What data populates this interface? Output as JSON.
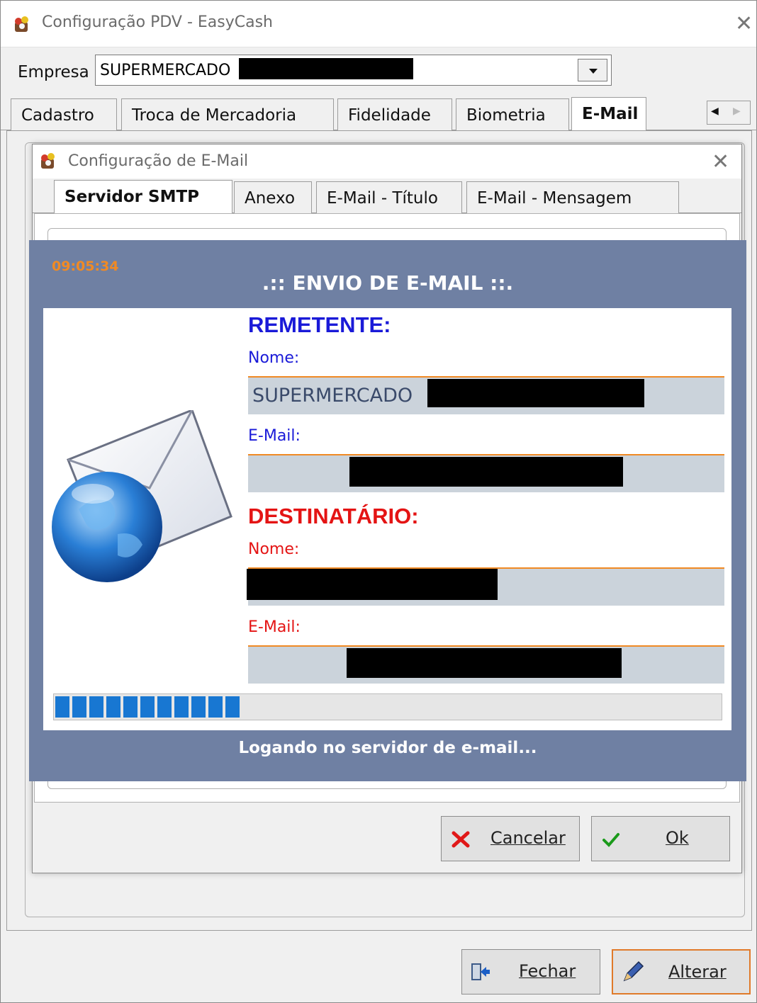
{
  "main_window": {
    "title": "Configuração PDV - EasyCash",
    "empresa_label": "Empresa",
    "empresa_value": "SUPERMERCADO",
    "tabs": [
      {
        "label": "Cadastro"
      },
      {
        "label": "Troca de Mercadoria"
      },
      {
        "label": "Fidelidade"
      },
      {
        "label": "Biometria"
      },
      {
        "label": "E-Mail"
      }
    ],
    "buttons": {
      "fechar": "Fechar",
      "alterar": "Alterar"
    }
  },
  "email_dialog": {
    "title": "Configuração de E-Mail",
    "tabs": [
      {
        "label": "Servidor SMTP"
      },
      {
        "label": "Anexo"
      },
      {
        "label": "E-Mail - Título"
      },
      {
        "label": "E-Mail - Mensagem"
      }
    ],
    "buttons": {
      "cancelar": "Cancelar",
      "ok": "Ok"
    }
  },
  "send_panel": {
    "time": "09:05:34",
    "heading": ".:: ENVIO DE E-MAIL ::.",
    "remetente": {
      "heading": "REMETENTE:",
      "nome_label": "Nome:",
      "nome_value": "SUPERMERCADO",
      "email_label": "E-Mail:"
    },
    "destinatario": {
      "heading": "DESTINATÁRIO:",
      "nome_label": "Nome:",
      "email_label": "E-Mail:"
    },
    "progress_fraction": 0.28,
    "status": "Logando no servidor de e-mail..."
  },
  "colors": {
    "panel_bg": "#6f80a3",
    "remetente": "#1a1ad8",
    "destinatario": "#e41414",
    "time": "#f08a24",
    "progress": "#1877d2"
  },
  "icons": [
    "app-icon",
    "close-icon",
    "dropdown-arrow-icon",
    "scroll-left-icon",
    "scroll-right-icon",
    "email-globe-icon",
    "cancel-x-icon",
    "ok-check-icon",
    "exit-door-icon",
    "edit-pen-icon"
  ]
}
